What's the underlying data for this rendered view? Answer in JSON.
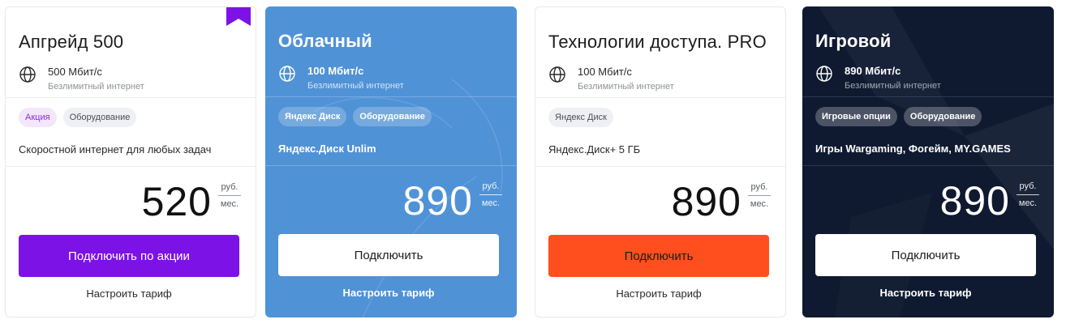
{
  "cards": [
    {
      "title": "Апгрейд 500",
      "speed": "500 Мбит/с",
      "speed_note": "Безлимитный интернет",
      "tags": [
        "Акция",
        "Оборудование"
      ],
      "feature": "Скоростной интернет для любых задач",
      "price": "520",
      "currency": "руб.",
      "period": "мес.",
      "button": "Подключить по акции",
      "tune": "Настроить тариф",
      "button_color": "#7C12E6",
      "badge_icon": "bookmark-ribbon-icon"
    },
    {
      "title": "Облачный",
      "speed": "100 Мбит/с",
      "speed_note": "Безлимитный интернет",
      "tags": [
        "Яндекс Диск",
        "Оборудование"
      ],
      "feature": "Яндекс.Диск Unlim",
      "price": "890",
      "currency": "руб.",
      "period": "мес.",
      "button": "Подключить",
      "tune": "Настроить тариф",
      "background": "#5092D6"
    },
    {
      "title": "Технологии доступа. PRO",
      "speed": "100 Мбит/с",
      "speed_note": "Безлимитный интернет",
      "tags": [
        "Яндекс Диск"
      ],
      "feature": "Яндекс.Диск+ 5 ГБ",
      "price": "890",
      "currency": "руб.",
      "period": "мес.",
      "button": "Подключить",
      "tune": "Настроить тариф",
      "button_color": "#FF4F1F"
    },
    {
      "title": "Игровой",
      "speed": "890 Мбит/с",
      "speed_note": "Безлимитный интернет",
      "tags": [
        "Игровые опции",
        "Оборудование"
      ],
      "feature": "Игры Wargaming, Фогейм, MY.GAMES",
      "price": "890",
      "currency": "руб.",
      "period": "мес.",
      "button": "Подключить",
      "tune": "Настроить тариф",
      "background": "#0F1A30"
    }
  ],
  "icons": {
    "speed": "globe-icon"
  }
}
